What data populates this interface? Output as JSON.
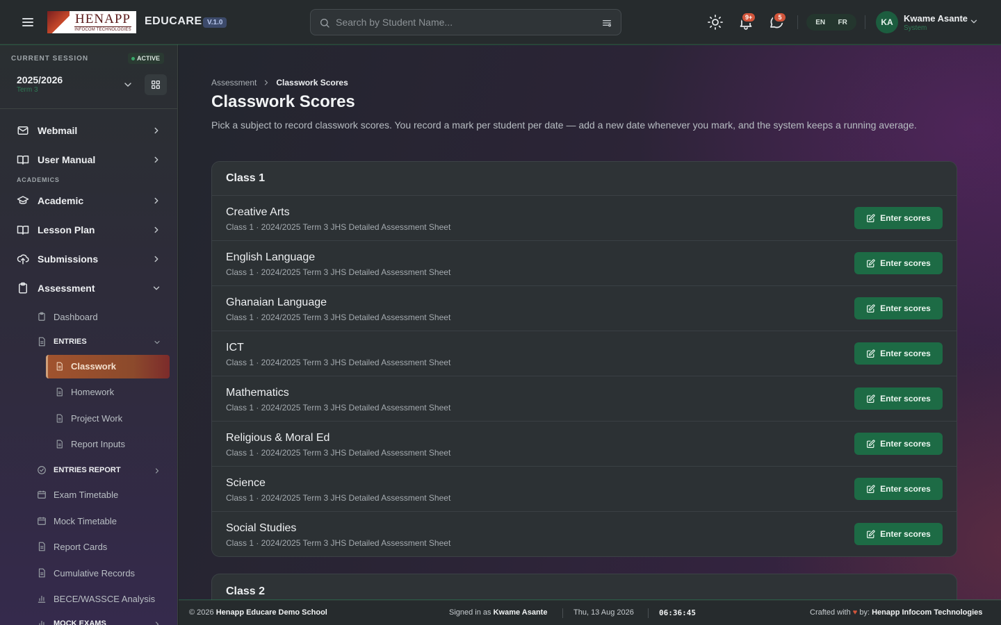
{
  "header": {
    "logo_text": "HENAPP",
    "logo_subtext": "INFOCOM TECHNOLOGIES",
    "app_name": "EDUCARE",
    "version": "V.1.0",
    "search_placeholder": "Search by Student Name...",
    "notifications_badge": "9+",
    "messages_badge": "5",
    "lang_en": "EN",
    "lang_fr": "FR",
    "user_initials": "KA",
    "user_name": "Kwame Asante",
    "user_role": "System",
    "colors": {
      "accent_green": "#1d6b45",
      "badge": "#d2553b"
    }
  },
  "sidebar": {
    "session_label": "CURRENT SESSION",
    "session_status": "ACTIVE",
    "session_year": "2025/2026",
    "session_term": "Term 3",
    "items": {
      "webmail": "Webmail",
      "user_manual": "User Manual",
      "academics_section": "ACADEMICS",
      "academic": "Academic",
      "lesson_plan": "Lesson Plan",
      "submissions": "Submissions",
      "assessment": "Assessment",
      "dashboard": "Dashboard",
      "entries": "ENTRIES",
      "classwork": "Classwork",
      "homework": "Homework",
      "project_work": "Project Work",
      "report_inputs": "Report Inputs",
      "entries_report": "ENTRIES REPORT",
      "exam_timetable": "Exam Timetable",
      "mock_timetable": "Mock Timetable",
      "report_cards": "Report Cards",
      "cumulative_records": "Cumulative Records",
      "bece_analysis": "BECE/WASSCE Analysis",
      "mock_exams": "MOCK EXAMS"
    }
  },
  "main": {
    "breadcrumb_parent": "Assessment",
    "breadcrumb_current": "Classwork Scores",
    "title": "Classwork Scores",
    "description": "Pick a subject to record classwork scores. You record a mark per student per date — add a new date whenever you mark, and the system keeps a running average.",
    "enter_label": "Enter scores",
    "class1": {
      "name": "Class 1",
      "subjects": [
        {
          "name": "Creative Arts",
          "meta": "Class 1 · 2024/2025 Term 3 JHS Detailed Assessment Sheet"
        },
        {
          "name": "English Language",
          "meta": "Class 1 · 2024/2025 Term 3 JHS Detailed Assessment Sheet"
        },
        {
          "name": "Ghanaian Language",
          "meta": "Class 1 · 2024/2025 Term 3 JHS Detailed Assessment Sheet"
        },
        {
          "name": "ICT",
          "meta": "Class 1 · 2024/2025 Term 3 JHS Detailed Assessment Sheet"
        },
        {
          "name": "Mathematics",
          "meta": "Class 1 · 2024/2025 Term 3 JHS Detailed Assessment Sheet"
        },
        {
          "name": "Religious & Moral Ed",
          "meta": "Class 1 · 2024/2025 Term 3 JHS Detailed Assessment Sheet"
        },
        {
          "name": "Science",
          "meta": "Class 1 · 2024/2025 Term 3 JHS Detailed Assessment Sheet"
        },
        {
          "name": "Social Studies",
          "meta": "Class 1 · 2024/2025 Term 3 JHS Detailed Assessment Sheet"
        }
      ]
    },
    "class2": {
      "name": "Class 2"
    }
  },
  "footer": {
    "copyright": "© 2026",
    "school": "Henapp Educare Demo School",
    "signed_in_label": "Signed in as",
    "signed_in_user": "Kwame Asante",
    "date": "Thu, 13 Aug 2026",
    "time": "06:36:45",
    "crafted_label": "Crafted with",
    "heart": "♥",
    "by_label": "by:",
    "company": "Henapp Infocom Technologies"
  }
}
